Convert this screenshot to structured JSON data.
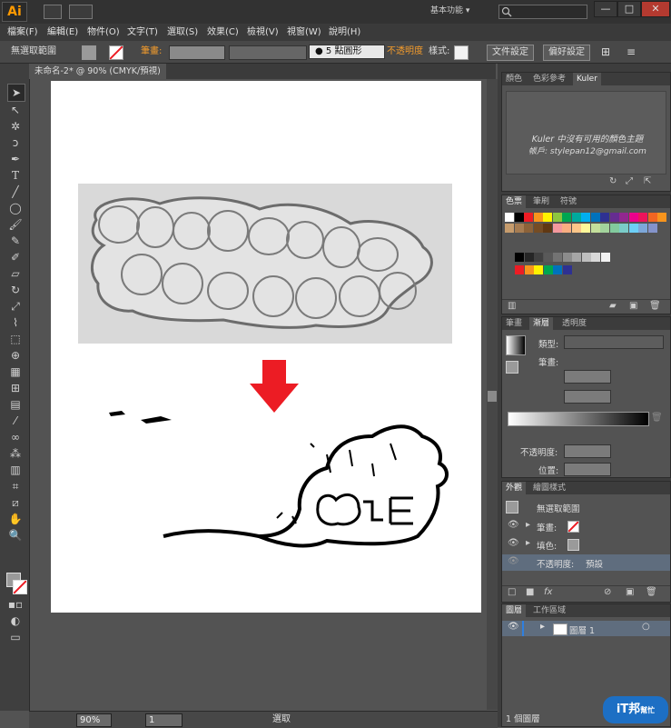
{
  "app": {
    "logo": "Ai",
    "workspace": "基本功能 ▾"
  },
  "window_buttons": [
    "—",
    "□",
    "✕"
  ],
  "menu": [
    "檔案(F)",
    "編輯(E)",
    "物件(O)",
    "文字(T)",
    "選取(S)",
    "效果(C)",
    "檢視(V)",
    "視窗(W)",
    "說明(H)"
  ],
  "control": {
    "selection": "無選取範圍",
    "stroke_label": "筆畫:",
    "brush": "● 5 點圓形",
    "opacity_label": "不透明度",
    "style_label": "樣式:",
    "doc_settings": "文件設定",
    "preferences": "偏好設定"
  },
  "document": {
    "tab": "未命名-2* @ 90% (CMYK/預視)"
  },
  "status": {
    "zoom": "90%",
    "artboard": "1",
    "tool": "選取"
  },
  "kuler": {
    "tabs": [
      "顏色",
      "色彩參考",
      "Kuler"
    ],
    "message": "Kuler 中沒有可用的顏色主題",
    "account": "帳戶: stylepan12@gmail.com"
  },
  "swatches": {
    "tabs": [
      "色票",
      "筆刷",
      "符號"
    ],
    "row1": [
      "#ffffff",
      "#000000",
      "#ed1c24",
      "#f7941d",
      "#fff200",
      "#8dc63f",
      "#00a651",
      "#00a99d",
      "#00aeef",
      "#0072bc",
      "#2e3192",
      "#662d91",
      "#92278f",
      "#ec008c",
      "#ed145b",
      "#f26522",
      "#f7941d"
    ],
    "row2": [
      "#c69c6d",
      "#a67c52",
      "#8c6239",
      "#754c24",
      "#603813",
      "#f5989d",
      "#f9ad81",
      "#fdc689",
      "#fff799",
      "#c4df9b",
      "#a3d39c",
      "#82ca9d",
      "#7accc8",
      "#6dcff6",
      "#7da7d9",
      "#8493ca"
    ],
    "gray_row": [
      "#000000",
      "#262626",
      "#404040",
      "#595959",
      "#737373",
      "#8c8c8c",
      "#a6a6a6",
      "#bfbfbf",
      "#d9d9d9",
      "#f2f2f2"
    ],
    "color_row": [
      "#ed1c24",
      "#f7941d",
      "#fff200",
      "#00a651",
      "#0072bc",
      "#2e3192"
    ]
  },
  "gradient": {
    "tabs": [
      "筆畫",
      "漸層",
      "透明度"
    ],
    "type_label": "類型:",
    "stroke_label": "筆畫:",
    "opacity_label": "不透明度:",
    "position_label": "位置:"
  },
  "appearance": {
    "tabs": [
      "外觀",
      "繪圖樣式"
    ],
    "header": "無選取範圍",
    "stroke_label": "筆畫:",
    "fill_label": "填色:",
    "opacity_label": "不透明度:",
    "opacity_value": "預設"
  },
  "layers": {
    "tabs": [
      "圖層",
      "工作區域"
    ],
    "layer_name": "圖層 1",
    "count": "1 個圖層"
  },
  "watermark": {
    "logo": "iT邦",
    "sub": "幫忙"
  },
  "colors": {
    "accent_orange": "#f29b2c",
    "arrow_red": "#ec1c24",
    "selected_row": "#5f6d7e"
  }
}
